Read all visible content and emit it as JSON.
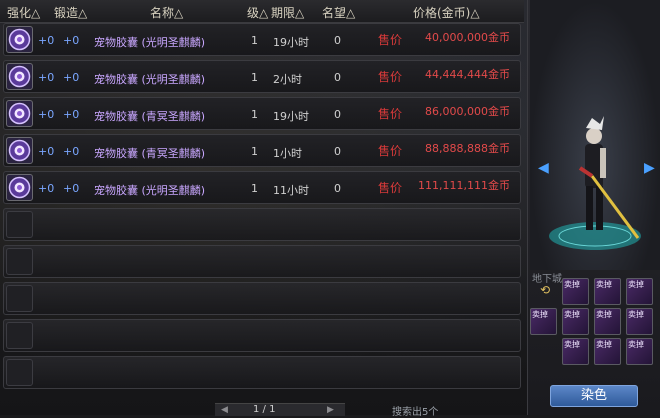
{
  "header": {
    "enhance": "强化△",
    "forge": "锻造△",
    "name": "名称△",
    "level": "级△",
    "duration": "期限△",
    "reputation": "名望△",
    "price": "价格(金币)△"
  },
  "rows": [
    {
      "enhance": "+0",
      "forge": "+0",
      "name": "宠物胶囊 (光明圣麒麟)",
      "level": "1",
      "duration": "19小时",
      "reputation": "0",
      "sell": "售价",
      "price": "40,000,000金币"
    },
    {
      "enhance": "+0",
      "forge": "+0",
      "name": "宠物胶囊 (光明圣麒麟)",
      "level": "1",
      "duration": "2小时",
      "reputation": "0",
      "sell": "售价",
      "price": "44,444,444金币"
    },
    {
      "enhance": "+0",
      "forge": "+0",
      "name": "宠物胶囊 (青冥圣麒麟)",
      "level": "1",
      "duration": "19小时",
      "reputation": "0",
      "sell": "售价",
      "price": "86,000,000金币"
    },
    {
      "enhance": "+0",
      "forge": "+0",
      "name": "宠物胶囊 (青冥圣麒麟)",
      "level": "1",
      "duration": "1小时",
      "reputation": "0",
      "sell": "售价",
      "price": "88,888,888金币"
    },
    {
      "enhance": "+0",
      "forge": "+0",
      "name": "宠物胶囊 (光明圣麒麟)",
      "level": "1",
      "duration": "11小时",
      "reputation": "0",
      "sell": "售价",
      "price": "111,111,111金币"
    }
  ],
  "pager": {
    "text": "1 / 1"
  },
  "search_result": "搜索出5个",
  "side": {
    "scene_label": "地下城",
    "dye_button": "染色",
    "inventory_badge": "卖掉"
  },
  "colors": {
    "price": "#e24a4a",
    "sell_label": "#d83a3a",
    "item_name": "#c9a7ff",
    "enhance": "#7aa6ff",
    "dye_button": "#3f6fb3"
  },
  "icons": {
    "row_item": "pet-capsule-icon",
    "pager_prev": "triangle-left-icon",
    "pager_next": "triangle-right-icon",
    "preview_prev": "triangle-left-icon",
    "preview_next": "triangle-right-icon",
    "cycle": "cycle-arrow-icon"
  }
}
